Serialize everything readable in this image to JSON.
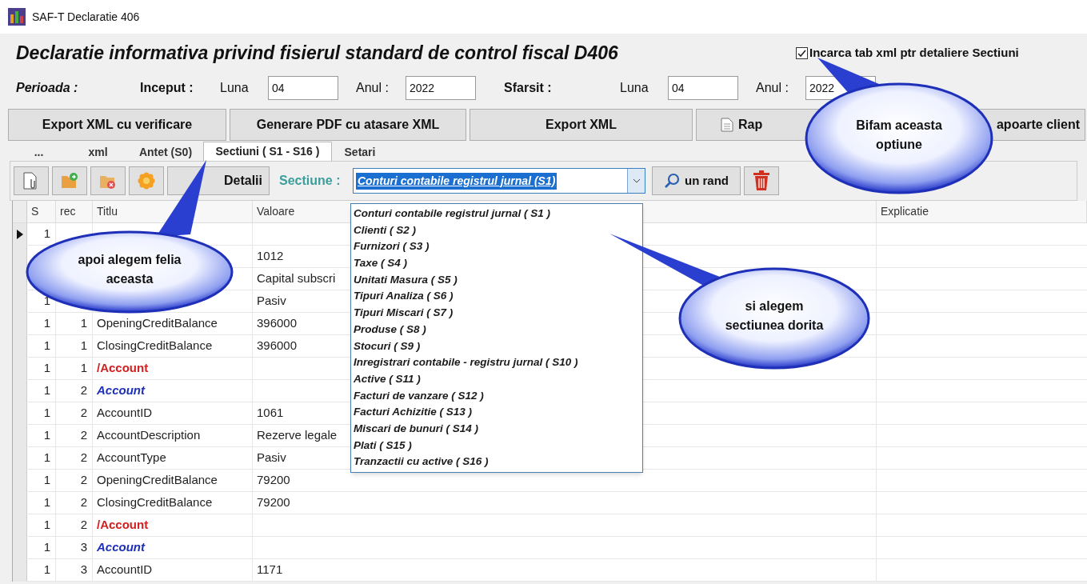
{
  "window": {
    "title": "SAF-T Declaratie 406"
  },
  "heading": "Declaratie informativa privind fisierul standard de control fiscal D406",
  "load_xml_option": {
    "label": "Incarca tab xml ptr detaliere Sectiuni",
    "checked": true
  },
  "period": {
    "label": "Perioada :",
    "start": {
      "label": "Inceput :",
      "month_label": "Luna",
      "month": "04",
      "year_label": "Anul :",
      "year": "2022"
    },
    "end": {
      "label": "Sfarsit :",
      "month_label": "Luna",
      "month": "04",
      "year_label": "Anul :",
      "year": "2022"
    }
  },
  "buttons": [
    {
      "label": "Export XML cu verificare",
      "kind": "plain"
    },
    {
      "label": "Generare PDF cu atasare XML",
      "kind": "plain"
    },
    {
      "label": "Export XML",
      "kind": "plain"
    },
    {
      "label": "Rap",
      "kind": "document"
    },
    {
      "label": "apoarte client",
      "kind": "plain"
    }
  ],
  "tabs": [
    {
      "label": "...",
      "selected": false
    },
    {
      "label": "xml",
      "selected": false
    },
    {
      "label": "Antet (S0)",
      "selected": false
    },
    {
      "label": "Sectiuni ( S1 - S16 )",
      "selected": true
    },
    {
      "label": "Setari",
      "selected": false
    }
  ],
  "toolbar": {
    "details_button": "Detalii",
    "section_label": "Sectiune :",
    "section_value": "Conturi contabile registrul jurnal  (S1)",
    "search_button": "un rand"
  },
  "section_options": [
    "Conturi contabile registrul jurnal  ( S1 )",
    "Clienti ( S2 )",
    "Furnizori ( S3 )",
    "Taxe ( S4 )",
    "Unitati Masura ( S5 )",
    "Tipuri Analiza ( S6 )",
    "Tipuri Miscari ( S7 )",
    "Produse ( S8 )",
    "Stocuri ( S9 )",
    "Inregistrari contabile - registru jurnal ( S10 )",
    "Active ( S11 )",
    "Facturi de vanzare ( S12 )",
    "Facturi Achizitie ( S13 )",
    "Miscari de bunuri ( S14 )",
    "Plati ( S15 )",
    "Tranzactii cu active ( S16 )"
  ],
  "grid": {
    "columns": [
      "S",
      "rec",
      "Titlu",
      "Valoare",
      "Explicatie"
    ],
    "rows": [
      {
        "current": true,
        "kind": "field",
        "s": "1"
      },
      {
        "current": false,
        "kind": "field",
        "value": "1012"
      },
      {
        "current": false,
        "kind": "field",
        "value": "Capital subscri"
      },
      {
        "current": false,
        "kind": "field",
        "s": "1",
        "value": "Pasiv"
      },
      {
        "current": false,
        "kind": "field",
        "s": "1",
        "rec": "1",
        "title": "OpeningCreditBalance",
        "value": "396000"
      },
      {
        "current": false,
        "kind": "field",
        "s": "1",
        "rec": "1",
        "title": "ClosingCreditBalance",
        "value": "396000"
      },
      {
        "current": false,
        "kind": "close",
        "s": "1",
        "rec": "1",
        "title": "/Account"
      },
      {
        "current": false,
        "kind": "open",
        "s": "1",
        "rec": "2",
        "title": "Account"
      },
      {
        "current": false,
        "kind": "field",
        "s": "1",
        "rec": "2",
        "title": "AccountID",
        "value": "1061"
      },
      {
        "current": false,
        "kind": "field",
        "s": "1",
        "rec": "2",
        "title": "AccountDescription",
        "value": "Rezerve legale"
      },
      {
        "current": false,
        "kind": "field",
        "s": "1",
        "rec": "2",
        "title": "AccountType",
        "value": "Pasiv"
      },
      {
        "current": false,
        "kind": "field",
        "s": "1",
        "rec": "2",
        "title": "OpeningCreditBalance",
        "value": "79200"
      },
      {
        "current": false,
        "kind": "field",
        "s": "1",
        "rec": "2",
        "title": "ClosingCreditBalance",
        "value": "79200"
      },
      {
        "current": false,
        "kind": "close",
        "s": "1",
        "rec": "2",
        "title": "/Account"
      },
      {
        "current": false,
        "kind": "open",
        "s": "1",
        "rec": "3",
        "title": "Account"
      },
      {
        "current": false,
        "kind": "field",
        "s": "1",
        "rec": "3",
        "title": "AccountID",
        "value": "1171"
      }
    ]
  },
  "callouts": [
    {
      "lines": [
        "Bifam aceasta",
        "optiune"
      ]
    },
    {
      "lines": [
        "apoi alegem felia",
        "aceasta"
      ]
    },
    {
      "lines": [
        "si alegem",
        "sectiunea dorita"
      ]
    }
  ]
}
